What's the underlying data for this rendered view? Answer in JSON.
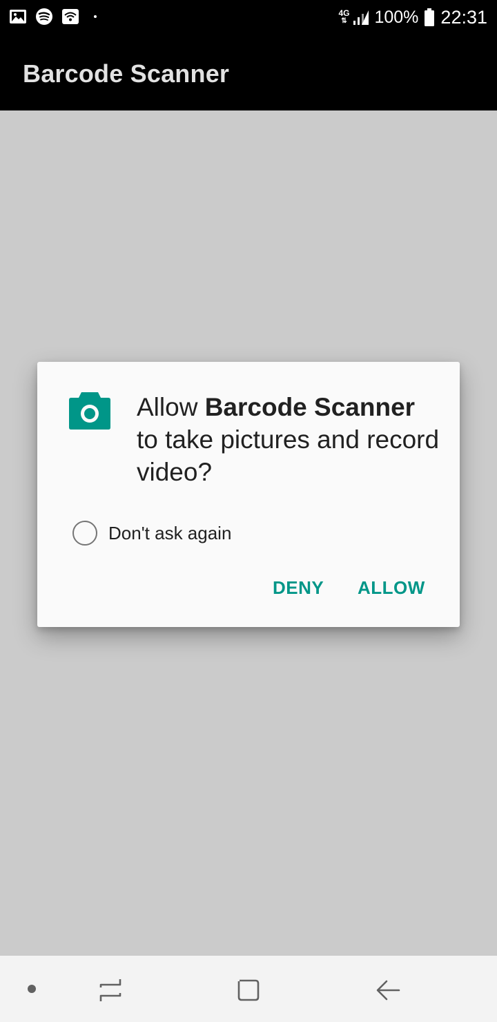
{
  "status_bar": {
    "left_icons": [
      "gallery-icon",
      "spotify-icon",
      "wifi-icon",
      "notification-dot"
    ],
    "network": "4G",
    "battery": "100%",
    "time": "22:31"
  },
  "toolbar": {
    "title": "Barcode Scanner"
  },
  "dialog": {
    "icon": "camera-icon",
    "message_prefix": "Allow ",
    "app_name": "Barcode Scanner",
    "message_suffix": " to take pictures and record video?",
    "checkbox_label": "Don't ask again",
    "checkbox_checked": false,
    "deny_label": "DENY",
    "allow_label": "ALLOW"
  },
  "nav_bar": {
    "items": [
      "dot-icon",
      "recent-apps-icon",
      "home-icon",
      "back-icon"
    ]
  },
  "colors": {
    "accent": "#009688",
    "toolbar": "#000000",
    "background": "#cbcbcb",
    "dialog": "#fafafa",
    "nav_bar": "#f3f3f3"
  }
}
